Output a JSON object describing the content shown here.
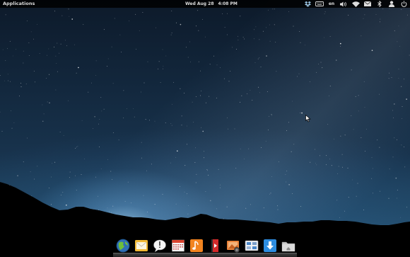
{
  "panel": {
    "applications_label": "Applications",
    "date": "Wed Aug 28",
    "time": "4:08 PM",
    "language": "en",
    "indicators": [
      "dropbox-icon",
      "keyboard-icon",
      "language-indicator",
      "volume-icon",
      "wifi-icon",
      "mail-icon",
      "bluetooth-icon",
      "user-icon",
      "power-icon"
    ]
  },
  "dock": {
    "items": [
      "web-browser",
      "mail",
      "messaging",
      "calendar",
      "music",
      "videos",
      "photos",
      "system-settings",
      "software-center",
      "files"
    ]
  },
  "colors": {
    "panel_bg": "#000000",
    "sky_top": "#0d1a2a",
    "sky_horizon": "#28587a"
  }
}
